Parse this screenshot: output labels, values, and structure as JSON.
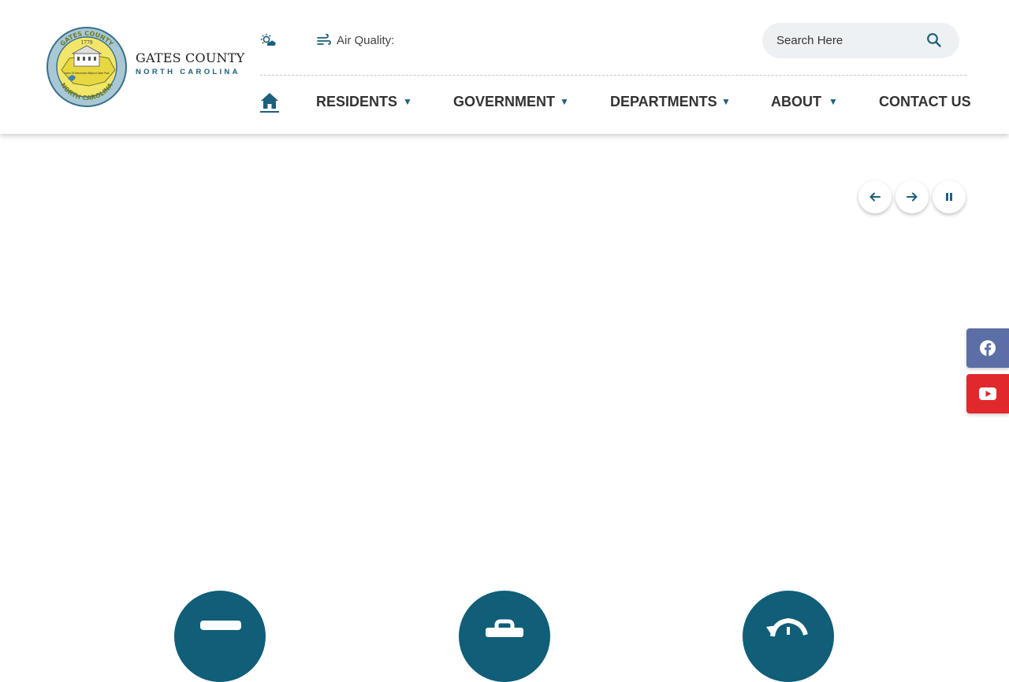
{
  "brand": {
    "title": "GATES COUNTY",
    "subtitle": "NORTH CAROLINA",
    "seal_year": "1779",
    "seal_ring_top": "GATES COUNTY",
    "seal_ring_bottom": "NORTH CAROLINA",
    "seal_caption": "Home Of Merchants Millpond State Park"
  },
  "topbar": {
    "weather_icon": "weather-sun-cloud-icon",
    "air_quality_label": "Air Quality:"
  },
  "search": {
    "placeholder": "Search Here"
  },
  "nav": {
    "home_icon": "home-icon",
    "items": [
      {
        "label": "RESIDENTS",
        "has_dropdown": true
      },
      {
        "label": "GOVERNMENT",
        "has_dropdown": true
      },
      {
        "label": "DEPARTMENTS",
        "has_dropdown": true
      },
      {
        "label": "ABOUT",
        "has_dropdown": true
      },
      {
        "label": "CONTACT US",
        "has_dropdown": false
      }
    ],
    "caret": "▼"
  },
  "slider": {
    "controls": [
      "arrow-left-icon",
      "arrow-right-icon",
      "pause-icon"
    ]
  },
  "social": [
    "facebook-icon",
    "youtube-icon"
  ],
  "quick_links": [
    "card-icon",
    "briefcase-icon",
    "history-icon"
  ],
  "colors": {
    "brand_teal": "#1d5f7c",
    "circle_teal": "#105e78",
    "facebook": "#5b6fa6",
    "youtube": "#e1282c",
    "search_bg": "#eef1f3"
  }
}
